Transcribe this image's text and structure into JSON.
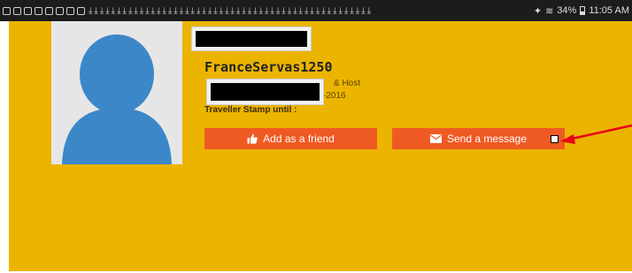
{
  "status_bar": {
    "battery": "34%",
    "time": "11:05 AM",
    "download_glyphs": "⤓⤓⤓⤓⤓⤓⤓⤓⤓⤓⤓⤓⤓⤓⤓⤓⤓⤓⤓⤓⤓⤓⤓⤓⤓⤓⤓⤓⤓⤓⤓⤓⤓⤓⤓⤓⤓⤓⤓⤓⤓⤓⤓⤓⤓⤓⤓⤓⤓⤓"
  },
  "profile": {
    "username": "FranceServas1250",
    "role_fragment": "& Host",
    "date_fragment": "c-2016",
    "stamp_label": "Traveller Stamp until :"
  },
  "actions": {
    "add_friend_label": "Add as a friend",
    "send_message_label": "Send a message"
  },
  "colors": {
    "panel": "#ebb400",
    "button": "#ef5a23",
    "arrow": "#e8001c"
  },
  "icons": [
    "thumbs-up-icon",
    "envelope-icon",
    "default-avatar-icon"
  ]
}
